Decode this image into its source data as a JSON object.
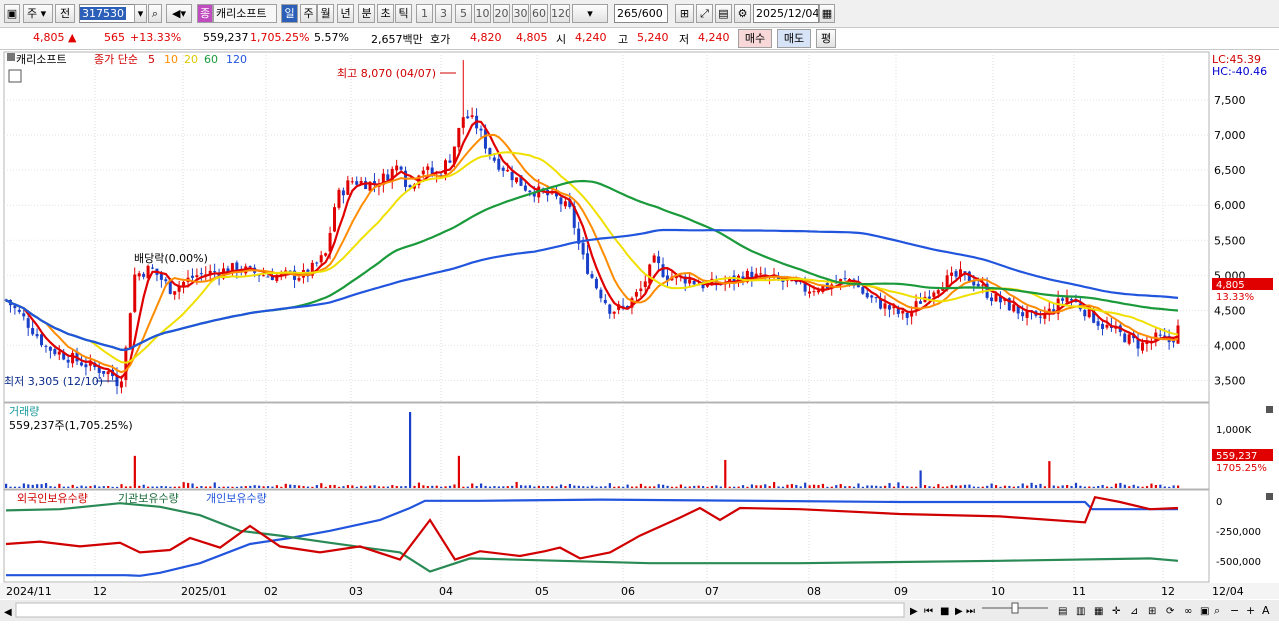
{
  "toolbar": {
    "type_label": "주",
    "prev_label": "전",
    "code_value": "317530",
    "name_badge": "종",
    "stock_name": "캐리소프트",
    "periods": [
      "일",
      "주",
      "월",
      "년",
      "분",
      "초",
      "틱"
    ],
    "active_period": "일",
    "intervals": [
      "1",
      "3",
      "5",
      "10",
      "20",
      "30",
      "60",
      "120"
    ],
    "count_value": "265",
    "count_total": "/600",
    "date_value": "2025/12/04"
  },
  "quote": {
    "price": "4,805",
    "arrow": "▲",
    "change": "565",
    "change_pct": "+13.33%",
    "volume": "559,237",
    "volume_pct": "1,705.25%",
    "turnover_pct": "5.57%",
    "amount": "2,657백만",
    "ask_label": "호가",
    "ask1": "4,820",
    "bid1": "4,805",
    "open_label": "시",
    "open": "4,240",
    "high_label": "고",
    "high": "5,240",
    "low_label": "저",
    "low": "4,240",
    "buy_label": "매수",
    "sell_label": "매도",
    "eval_label": "평"
  },
  "price_pane": {
    "name_tag": "캐리소프트",
    "legend_label": "종가 단순",
    "ma_periods": [
      "5",
      "10",
      "20",
      "60",
      "120"
    ],
    "ma_colors": [
      "#e00000",
      "#ff8c00",
      "#f0e000",
      "#1a9a3a",
      "#2255dd"
    ],
    "high_annotation": "최고 8,070 (04/07)",
    "low_annotation": "최저 3,305 (12/10)",
    "dividend_label": "배당락(0.00%)",
    "lc_label": "LC:45.39",
    "hc_label": "HC:-40.46",
    "y_ticks": [
      "7,500",
      "7,000",
      "6,500",
      "6,000",
      "5,500",
      "5,000",
      "4,500",
      "4,000",
      "3,500"
    ],
    "price_tag": "4,805",
    "pct_tag": "13.33%"
  },
  "volume_pane": {
    "title": "거래량",
    "value_label": "559,237주(1,705.25%)",
    "y_tick": "1,000K",
    "tag_value": "559,237",
    "tag_pct": "1705.25%"
  },
  "holding_pane": {
    "legends": [
      "외국인보유수량",
      "기관보유수량",
      "개인보유수량"
    ],
    "y_ticks": [
      "0",
      "-250,000",
      "-500,000"
    ]
  },
  "x_axis": {
    "labels": [
      "2024/11",
      "12",
      "2025/01",
      "02",
      "03",
      "04",
      "05",
      "06",
      "07",
      "08",
      "09",
      "10",
      "11",
      "12",
      "12/04"
    ]
  },
  "chart_data": {
    "type": "candlestick",
    "title": "캐리소프트",
    "ylim": [
      3250,
      8100
    ],
    "series_ma": [
      "5",
      "10",
      "20",
      "60",
      "120"
    ],
    "close_keypoints": [
      {
        "x": "2024/11",
        "y": 4600
      },
      {
        "x": "12",
        "y": 3800
      },
      {
        "x": "12/10",
        "y": 3305
      },
      {
        "x": "2025/01",
        "y": 5000
      },
      {
        "x": "02",
        "y": 4950
      },
      {
        "x": "03",
        "y": 6400
      },
      {
        "x": "04",
        "y": 7100
      },
      {
        "x": "04/07",
        "y": 8070
      },
      {
        "x": "05",
        "y": 6100
      },
      {
        "x": "06",
        "y": 4400
      },
      {
        "x": "07",
        "y": 4850
      },
      {
        "x": "08",
        "y": 4900
      },
      {
        "x": "09",
        "y": 4600
      },
      {
        "x": "10",
        "y": 4600
      },
      {
        "x": "11",
        "y": 4200
      },
      {
        "x": "12",
        "y": 3950
      },
      {
        "x": "12/04",
        "y": 4805
      }
    ],
    "volume_last": 559237
  }
}
